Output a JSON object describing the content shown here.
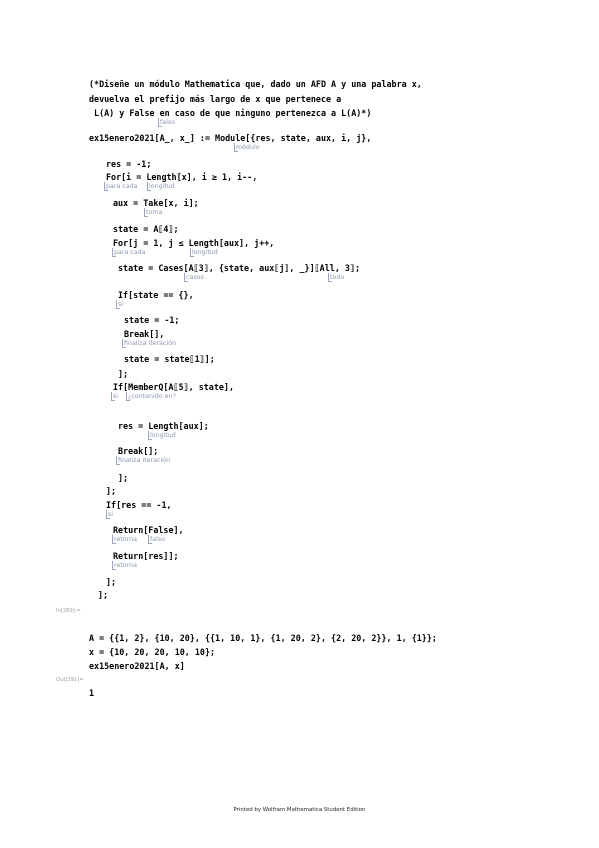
{
  "code_lines": [
    "(*Diseñe un módulo Mathematica que, dado un AFD A y una palabra x,",
    "devuelva el prefijo más largo de x que pertenece a",
    " L(A) y False en caso de que ninguno pertenezca a L(A)*)",
    "ex15enero2021[A_, x_] := Module[{res, state, aux, i, j},",
    "res = -1;",
    "For[i = Length[x], i ≥ 1, i--,",
    "aux = Take[x, i];",
    "state = A⟦4⟧;",
    "For[j = 1, j ≤ Length[aux], j++,",
    "state = Cases[A⟦3⟧, {state, aux⟦j⟧, _}]⟦All, 3⟧;",
    "If[state == {},",
    "state = -1;",
    "Break[],",
    "state = state⟦1⟧];",
    "];",
    "If[MemberQ[A⟦5⟧, state],",
    "res = Length[aux];",
    "Break[];",
    "];",
    "];",
    "If[res == -1,",
    "Return[False],",
    "Return[res]];",
    "];",
    "];"
  ],
  "hints": [
    "falso",
    "módulo",
    "para cada",
    "longitud",
    "toma",
    "para cada",
    "longitud",
    "casos",
    "todo",
    "si",
    "finaliza iteración",
    "si",
    "¿contenido en?",
    "longitud",
    "finaliza iteración",
    "si",
    "retorna",
    "falso",
    "retorna"
  ],
  "input_label": "In[289]:=",
  "output_label": "Out[291]=",
  "input_lines": [
    "A = {{1, 2}, {10, 20}, {{1, 10, 1}, {1, 20, 2}, {2, 20, 2}}, 1, {1}};",
    "x = {10, 20, 20, 10, 10};",
    "ex15enero2021[A, x]"
  ],
  "output_value": "1",
  "footer": "Printed by Wolfram Mathematica Student Edition"
}
